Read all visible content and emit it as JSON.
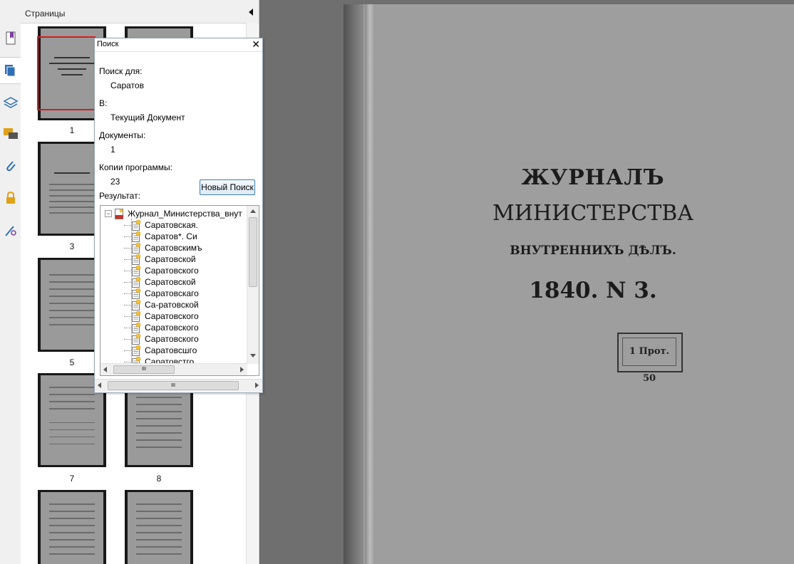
{
  "pages_panel": {
    "title": "Страницы",
    "thumbnails": [
      {
        "label": "1",
        "selected": true
      },
      {
        "label": "",
        "selected": false
      },
      {
        "label": "",
        "selected": false
      },
      {
        "label": "3",
        "selected": false
      },
      {
        "label": "5",
        "selected": false
      },
      {
        "label": "7",
        "selected": false
      },
      {
        "label": "8",
        "selected": false
      },
      {
        "label": "",
        "selected": false
      },
      {
        "label": "",
        "selected": false
      }
    ]
  },
  "toolbar": {
    "icons": [
      "bookmark-icon",
      "pages-icon",
      "layers-icon",
      "comments-icon",
      "attachments-icon",
      "security-icon",
      "signatures-icon"
    ]
  },
  "search": {
    "title": "Поиск",
    "close": "✕",
    "search_for_label": "Поиск для:",
    "search_for_value": "Саратов",
    "in_label": "В:",
    "in_value": "Текущий Документ",
    "documents_label": "Документы:",
    "documents_value": "1",
    "instances_label": "Копии программы:",
    "instances_value": "23",
    "new_search_label": "Новый Поиск",
    "result_label": "Результат:",
    "tree_root": "Журнал_Министерства_внут",
    "results": [
      "Саратовская.",
      "Саратов*. Си",
      "Саратовскимъ",
      "Саратовской",
      "Саратовского",
      "Саратовской",
      "Саратовскаго",
      "Са-ратовской",
      "Саратовского",
      "Саратовского",
      "Саратовского",
      "Саратовсшго",
      "Саратовстго"
    ],
    "scroll_grip": "III"
  },
  "document": {
    "line1": "ЖУРНАЛЪ",
    "line2": "МИНИСТЕРСТВА",
    "line3": "ВНУТРЕННИХЪ ДѢЛЪ.",
    "line4": "1840. N 3.",
    "stamp": "1 Прот. 50"
  },
  "colors": {
    "selection": "#d21d1d",
    "button_border": "#3c7fb1",
    "toolbar_icon_blue": "#2f6fb4",
    "toolbar_icon_orange": "#e0a21a"
  }
}
